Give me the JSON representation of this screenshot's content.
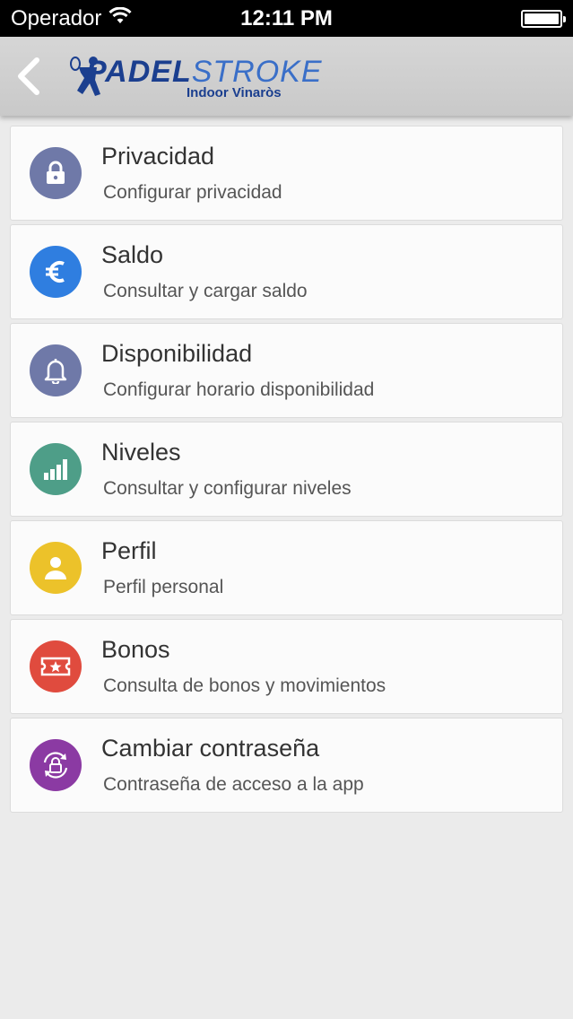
{
  "status_bar": {
    "carrier": "Operador",
    "time": "12:11 PM"
  },
  "nav": {
    "logo_main_a": "PADEL",
    "logo_main_b": "STROKE",
    "logo_sub": "Indoor Vinaròs"
  },
  "menu": {
    "items": [
      {
        "title": "Privacidad",
        "subtitle": "Configurar privacidad",
        "icon": "lock-icon",
        "color": "#6f79a8"
      },
      {
        "title": "Saldo",
        "subtitle": "Consultar y cargar saldo",
        "icon": "euro-icon",
        "color": "#2f7ee0"
      },
      {
        "title": "Disponibilidad",
        "subtitle": "Configurar horario disponibilidad",
        "icon": "bell-icon",
        "color": "#6f79a8"
      },
      {
        "title": "Niveles",
        "subtitle": "Consultar y configurar niveles",
        "icon": "bars-icon",
        "color": "#4e9e88"
      },
      {
        "title": "Perfil",
        "subtitle": "Perfil personal",
        "icon": "user-icon",
        "color": "#ecc22a"
      },
      {
        "title": "Bonos",
        "subtitle": "Consulta de bonos y movimientos",
        "icon": "ticket-icon",
        "color": "#e04b3e"
      },
      {
        "title": "Cambiar contraseña",
        "subtitle": "Contraseña de acceso a la app",
        "icon": "lock-refresh-icon",
        "color": "#8b3aa3"
      }
    ]
  }
}
